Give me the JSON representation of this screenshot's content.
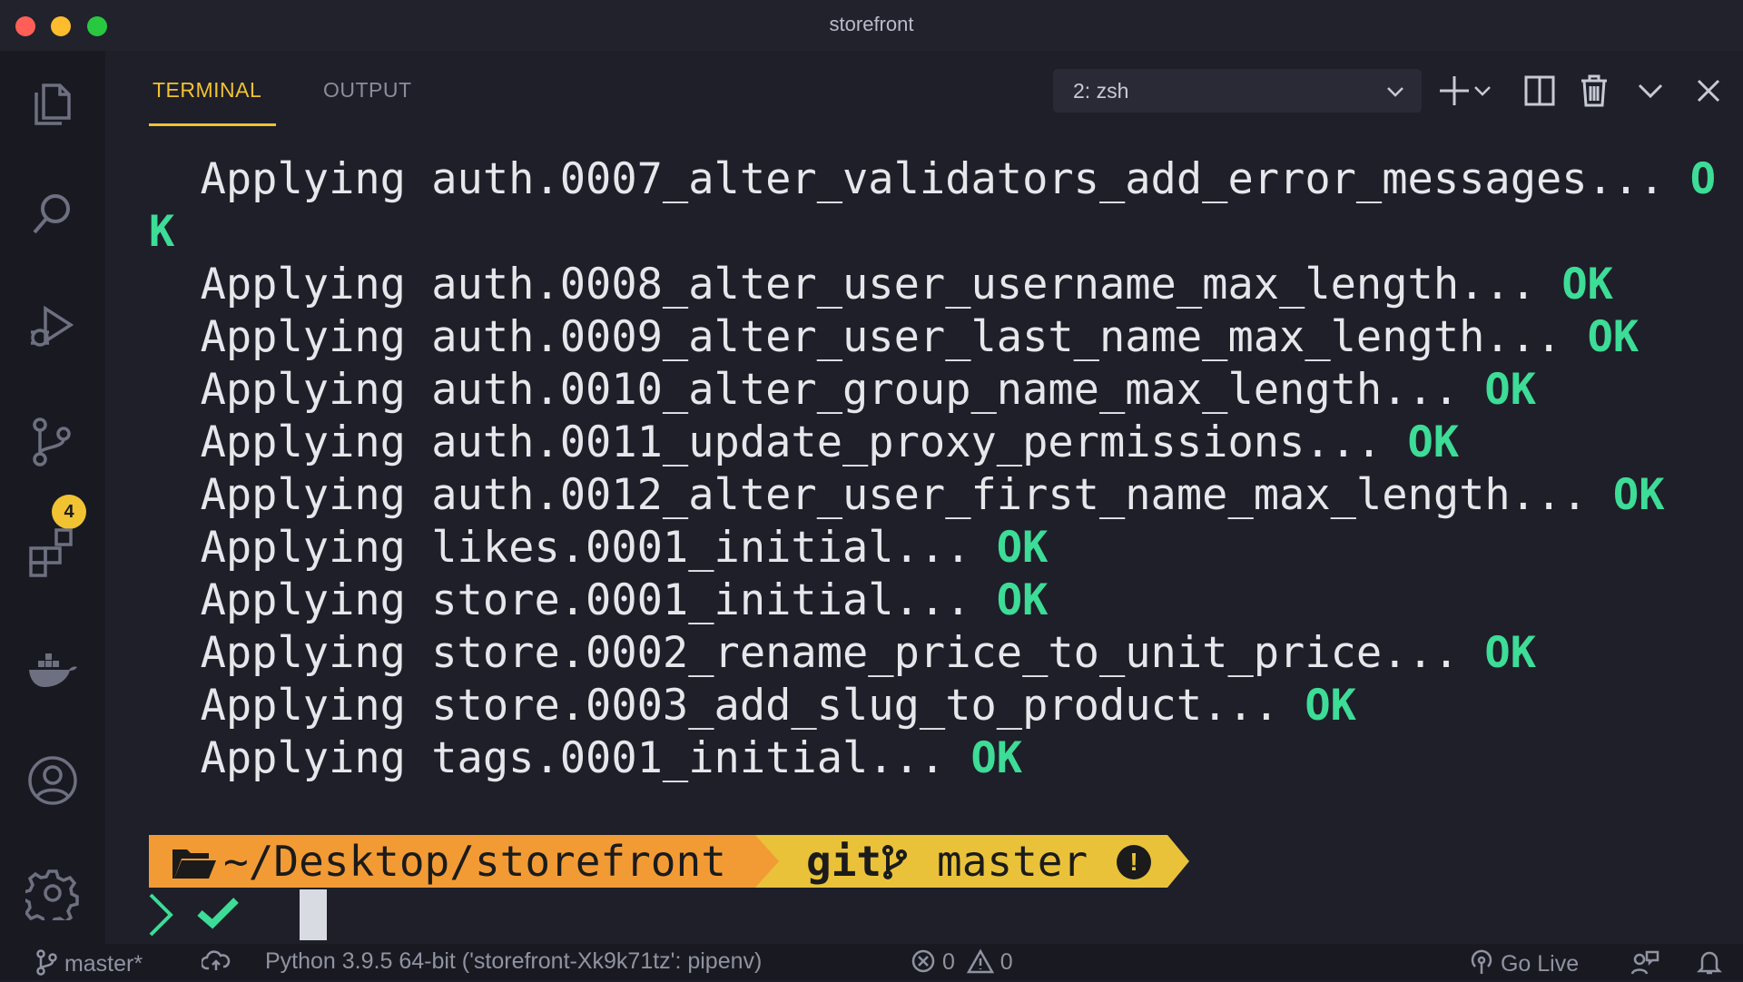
{
  "window": {
    "title": "storefront"
  },
  "activitybar": {
    "items": [
      {
        "name": "explorer-icon"
      },
      {
        "name": "search-icon"
      },
      {
        "name": "run-debug-icon"
      },
      {
        "name": "source-control-icon"
      },
      {
        "name": "extensions-icon"
      },
      {
        "name": "docker-icon"
      },
      {
        "name": "accounts-icon"
      },
      {
        "name": "settings-gear-icon"
      }
    ],
    "source_control_badge": "4"
  },
  "panel": {
    "tabs": [
      {
        "label": "TERMINAL",
        "active": true
      },
      {
        "label": "OUTPUT",
        "active": false
      }
    ],
    "terminal_selector": "2: zsh",
    "tools": [
      "add-terminal-icon",
      "dropdown-icon",
      "split-terminal-icon",
      "trash-icon",
      "chevron-down-icon",
      "close-icon"
    ]
  },
  "terminal": {
    "lines": [
      {
        "text": "  Applying auth.0007_alter_validators_add_error_messages...",
        "status": "O"
      },
      {
        "text": "",
        "status": "K"
      },
      {
        "text": "  Applying auth.0008_alter_user_username_max_length...",
        "status": "OK"
      },
      {
        "text": "  Applying auth.0009_alter_user_last_name_max_length...",
        "status": "OK"
      },
      {
        "text": "  Applying auth.0010_alter_group_name_max_length...",
        "status": "OK"
      },
      {
        "text": "  Applying auth.0011_update_proxy_permissions...",
        "status": "OK"
      },
      {
        "text": "  Applying auth.0012_alter_user_first_name_max_length...",
        "status": "OK"
      },
      {
        "text": "  Applying likes.0001_initial...",
        "status": "OK"
      },
      {
        "text": "  Applying store.0001_initial...",
        "status": "OK"
      },
      {
        "text": "  Applying store.0002_rename_price_to_unit_price...",
        "status": "OK"
      },
      {
        "text": "  Applying store.0003_add_slug_to_product...",
        "status": "OK"
      },
      {
        "text": "  Applying tags.0001_initial...",
        "status": "OK"
      }
    ],
    "prompt": {
      "path": "~/Desktop/storefront",
      "vcs": "git",
      "branch": "master",
      "status_mark": "!"
    }
  },
  "statusbar": {
    "branch": "master*",
    "python": "Python 3.9.5 64-bit ('storefront-Xk9k71tz': pipenv)",
    "errors": "0",
    "warnings": "0",
    "go_live": "Go Live"
  },
  "colors": {
    "accent": "#f1c232",
    "ok": "#3ddc97",
    "prompt_folder": "#f29b35",
    "prompt_git": "#e9c23a"
  }
}
